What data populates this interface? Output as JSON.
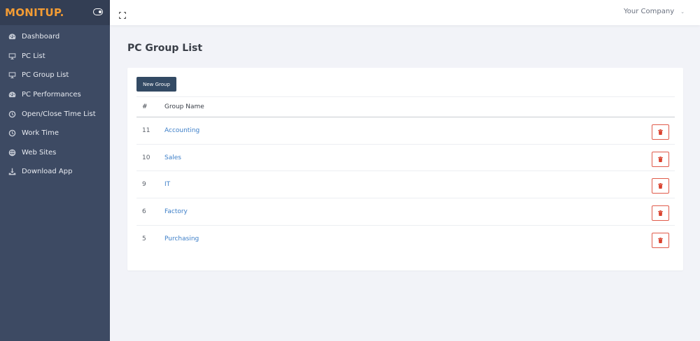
{
  "brand": {
    "name": "MONITUP."
  },
  "topbar": {
    "company": "Your Company"
  },
  "sidebar": {
    "items": [
      {
        "label": "Dashboard",
        "icon": "dashboard-icon"
      },
      {
        "label": "PC List",
        "icon": "monitor-icon"
      },
      {
        "label": "PC Group List",
        "icon": "monitor-icon"
      },
      {
        "label": "PC Performances",
        "icon": "gauge-icon"
      },
      {
        "label": "Open/Close Time List",
        "icon": "clock-icon"
      },
      {
        "label": "Work Time",
        "icon": "clock-icon"
      },
      {
        "label": "Web Sites",
        "icon": "globe-icon"
      },
      {
        "label": "Download App",
        "icon": "download-icon"
      }
    ]
  },
  "main": {
    "title": "PC Group List",
    "new_button": "New Group",
    "table": {
      "headers": [
        "#",
        "Group Name"
      ],
      "rows": [
        {
          "id": "11",
          "name": "Accounting"
        },
        {
          "id": "10",
          "name": "Sales"
        },
        {
          "id": "9",
          "name": "IT"
        },
        {
          "id": "6",
          "name": "Factory"
        },
        {
          "id": "5",
          "name": "Purchasing"
        }
      ]
    }
  },
  "colors": {
    "sidebar_bg": "#3d4a63",
    "brand_accent": "#f39c34",
    "primary_button": "#334a64",
    "link": "#3d7fc8",
    "danger": "#d9422e"
  }
}
